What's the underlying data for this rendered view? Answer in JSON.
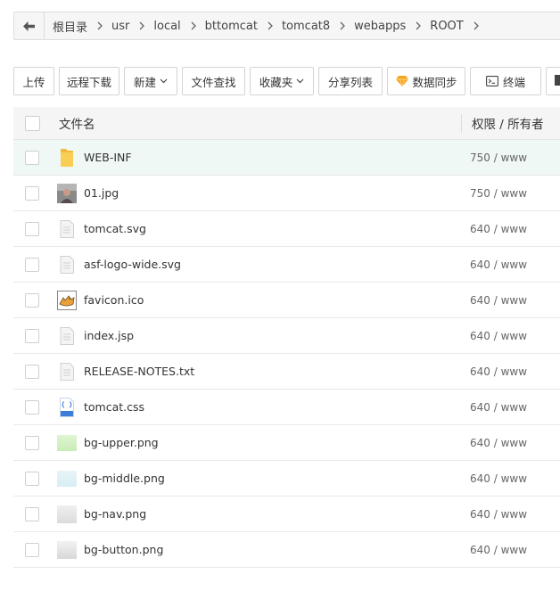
{
  "breadcrumb": {
    "items": [
      "根目录",
      "usr",
      "local",
      "bttomcat",
      "tomcat8",
      "webapps",
      "ROOT"
    ]
  },
  "toolbar": {
    "upload": "上传",
    "remote_download": "远程下载",
    "new": "新建",
    "file_search": "文件查找",
    "favorites": "收藏夹",
    "share_list": "分享列表",
    "data_sync": "数据同步",
    "terminal": "终端"
  },
  "table": {
    "headers": {
      "name": "文件名",
      "perm": "权限 / 所有者"
    },
    "rows": [
      {
        "name": "WEB-INF",
        "perm": "750 / www",
        "icon": "folder-icon"
      },
      {
        "name": "01.jpg",
        "perm": "750 / www",
        "icon": "image-thumbnail-icon"
      },
      {
        "name": "tomcat.svg",
        "perm": "640 / www",
        "icon": "text-file-icon"
      },
      {
        "name": "asf-logo-wide.svg",
        "perm": "640 / www",
        "icon": "text-file-icon"
      },
      {
        "name": "favicon.ico",
        "perm": "640 / www",
        "icon": "tomcat-favicon-icon"
      },
      {
        "name": "index.jsp",
        "perm": "640 / www",
        "icon": "text-file-icon"
      },
      {
        "name": "RELEASE-NOTES.txt",
        "perm": "640 / www",
        "icon": "text-file-icon"
      },
      {
        "name": "tomcat.css",
        "perm": "640 / www",
        "icon": "css-file-icon"
      },
      {
        "name": "bg-upper.png",
        "perm": "640 / www",
        "icon": "green-swatch-icon"
      },
      {
        "name": "bg-middle.png",
        "perm": "640 / www",
        "icon": "lightblue-swatch-icon"
      },
      {
        "name": "bg-nav.png",
        "perm": "640 / www",
        "icon": "grey-swatch-icon"
      },
      {
        "name": "bg-button.png",
        "perm": "640 / www",
        "icon": "grey-swatch-icon"
      }
    ]
  },
  "colors": {
    "highlight_row": "#f0f8f6",
    "folder": "#f9c94a",
    "sync_icon": "#f5a623"
  }
}
